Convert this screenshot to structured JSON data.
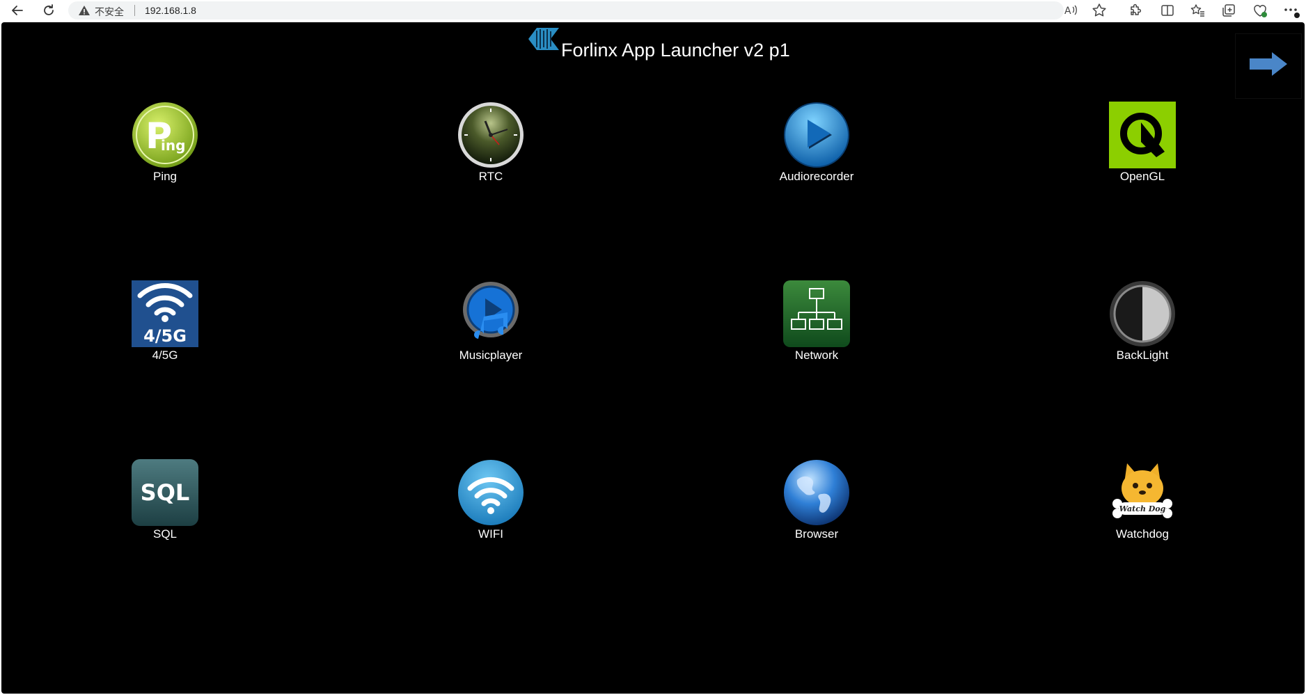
{
  "browser": {
    "insecure_label": "不安全",
    "url": "192.168.1.8"
  },
  "page": {
    "title": "Forlinx App Launcher v2 p1",
    "apps": [
      {
        "label": "Ping"
      },
      {
        "label": "RTC"
      },
      {
        "label": "Audiorecorder"
      },
      {
        "label": "OpenGL"
      },
      {
        "label": "4/5G"
      },
      {
        "label": "Musicplayer"
      },
      {
        "label": "Network"
      },
      {
        "label": "BackLight"
      },
      {
        "label": "SQL"
      },
      {
        "label": "WIFI"
      },
      {
        "label": "Browser"
      },
      {
        "label": "Watchdog"
      }
    ],
    "icon_text": {
      "ping_big": "P",
      "ping_small": "ing",
      "g45": "4/5G",
      "sql": "SQL",
      "watchdog": "Watch Dog"
    }
  },
  "colors": {
    "page_bg": "#000000",
    "title": "#ffffff",
    "next_arrow": "#4a86c8"
  }
}
